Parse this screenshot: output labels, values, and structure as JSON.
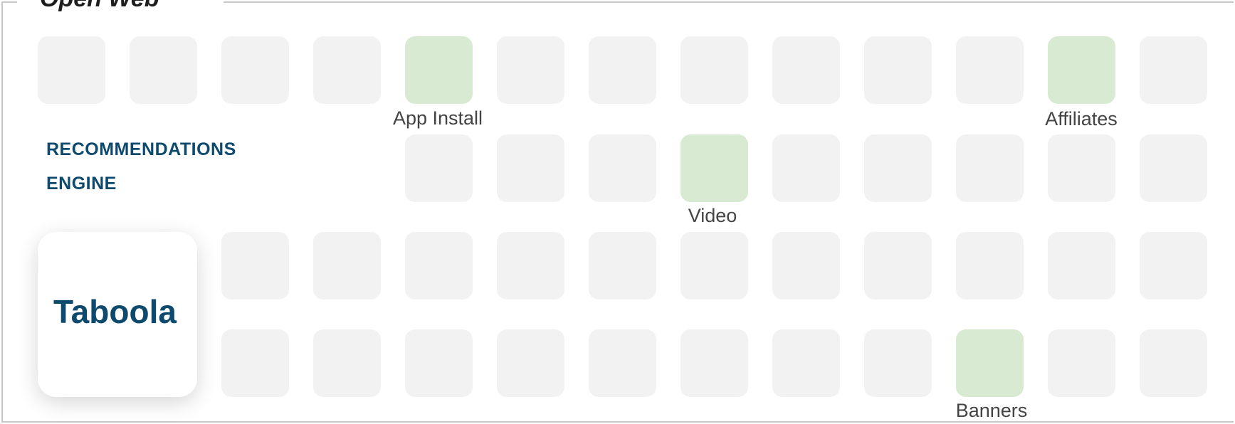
{
  "frame": {
    "title": "Open Web"
  },
  "engine": {
    "line1": "RECOMMENDATIONS",
    "line2": "ENGINE"
  },
  "logo": {
    "text": "Taboola",
    "color": "#0e4a6e"
  },
  "colors": {
    "tile": "#f2f2f2",
    "highlight": "#d9ead3",
    "heading": "#0e4a6e",
    "label": "#444444"
  },
  "highlights": [
    {
      "label": "App Install"
    },
    {
      "label": "Affiliates"
    },
    {
      "label": "Video"
    },
    {
      "label": "Banners"
    }
  ]
}
